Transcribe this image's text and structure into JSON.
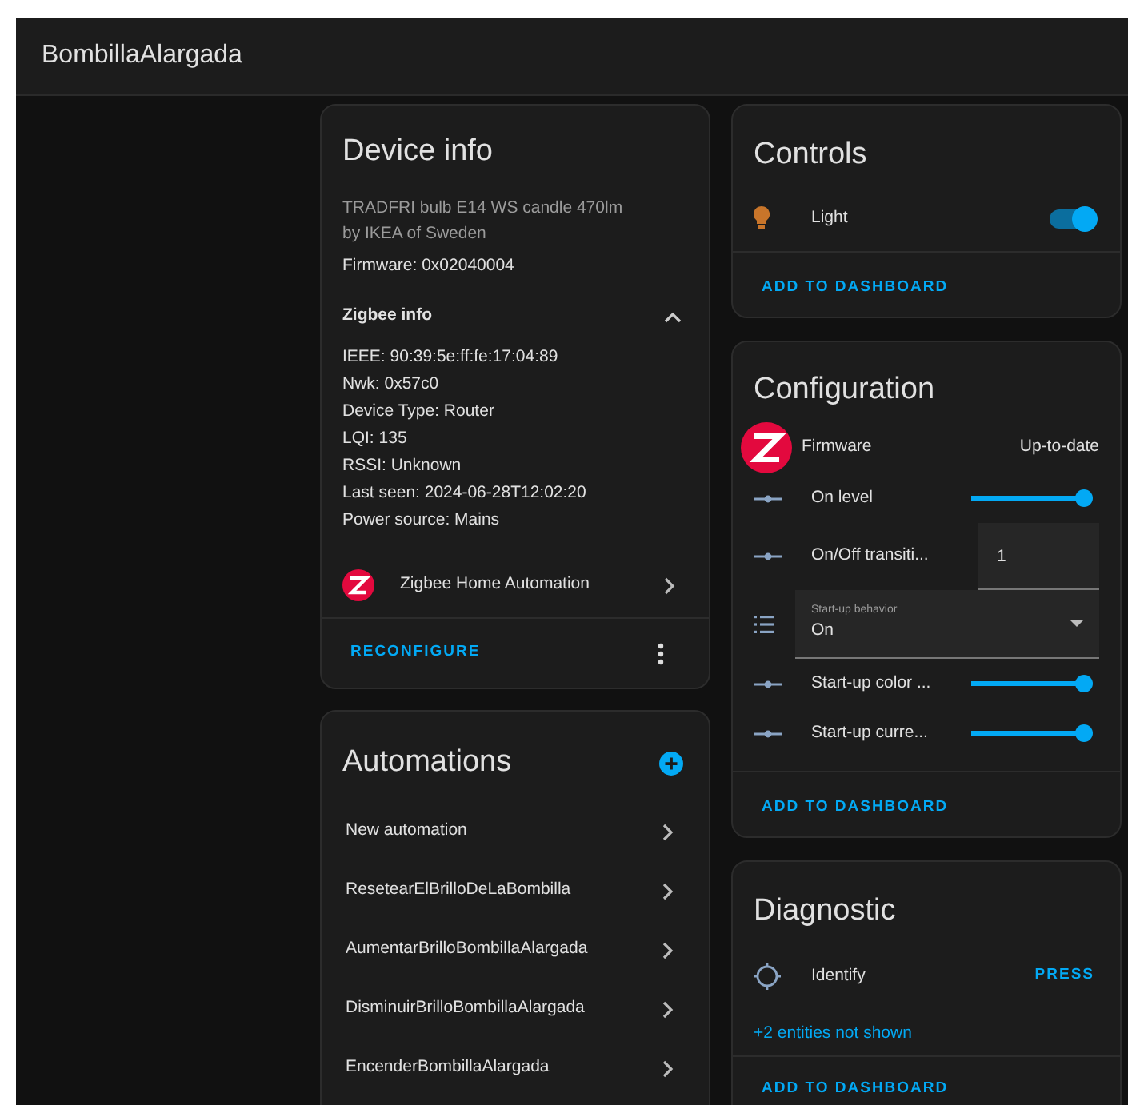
{
  "header": {
    "title": "BombillaAlargada"
  },
  "device_info": {
    "title": "Device info",
    "model": "TRADFRI bulb E14 WS candle 470lm",
    "manufacturer": "by IKEA of Sweden",
    "firmware": "Firmware: 0x02040004",
    "zigbee": {
      "title": "Zigbee info",
      "expanded": true,
      "lines": [
        "IEEE: 90:39:5e:ff:fe:17:04:89",
        "Nwk: 0x57c0",
        "Device Type: Router",
        "LQI: 135",
        "RSSI: Unknown",
        "Last seen: 2024-06-28T12:02:20",
        "Power source: Mains"
      ]
    },
    "integration": "Zigbee Home Automation",
    "action": "RECONFIGURE"
  },
  "automations": {
    "title": "Automations",
    "items": [
      "New automation",
      "ResetearElBrilloDeLaBombilla",
      "AumentarBrilloBombillaAlargada",
      "DisminuirBrilloBombillaAlargada",
      "EncenderBombillaAlargada"
    ]
  },
  "controls": {
    "title": "Controls",
    "entities": [
      {
        "name": "Light",
        "on": true
      }
    ],
    "action": "ADD TO DASHBOARD"
  },
  "configuration": {
    "title": "Configuration",
    "entities": [
      {
        "kind": "firmware",
        "name": "Firmware",
        "value": "Up-to-date"
      },
      {
        "kind": "slider",
        "name": "On level",
        "level": 1
      },
      {
        "kind": "number",
        "name": "On/Off transiti...",
        "value": "1"
      },
      {
        "kind": "select",
        "label": "Start-up behavior",
        "value": "On"
      },
      {
        "kind": "slider",
        "name": "Start-up color ...",
        "level": 1
      },
      {
        "kind": "slider",
        "name": "Start-up curre...",
        "level": 1
      }
    ],
    "action": "ADD TO DASHBOARD"
  },
  "diagnostic": {
    "title": "Diagnostic",
    "entities": [
      {
        "name": "Identify",
        "action": "PRESS"
      }
    ],
    "hidden_note": "+2 entities not shown",
    "action": "ADD TO DASHBOARD"
  }
}
